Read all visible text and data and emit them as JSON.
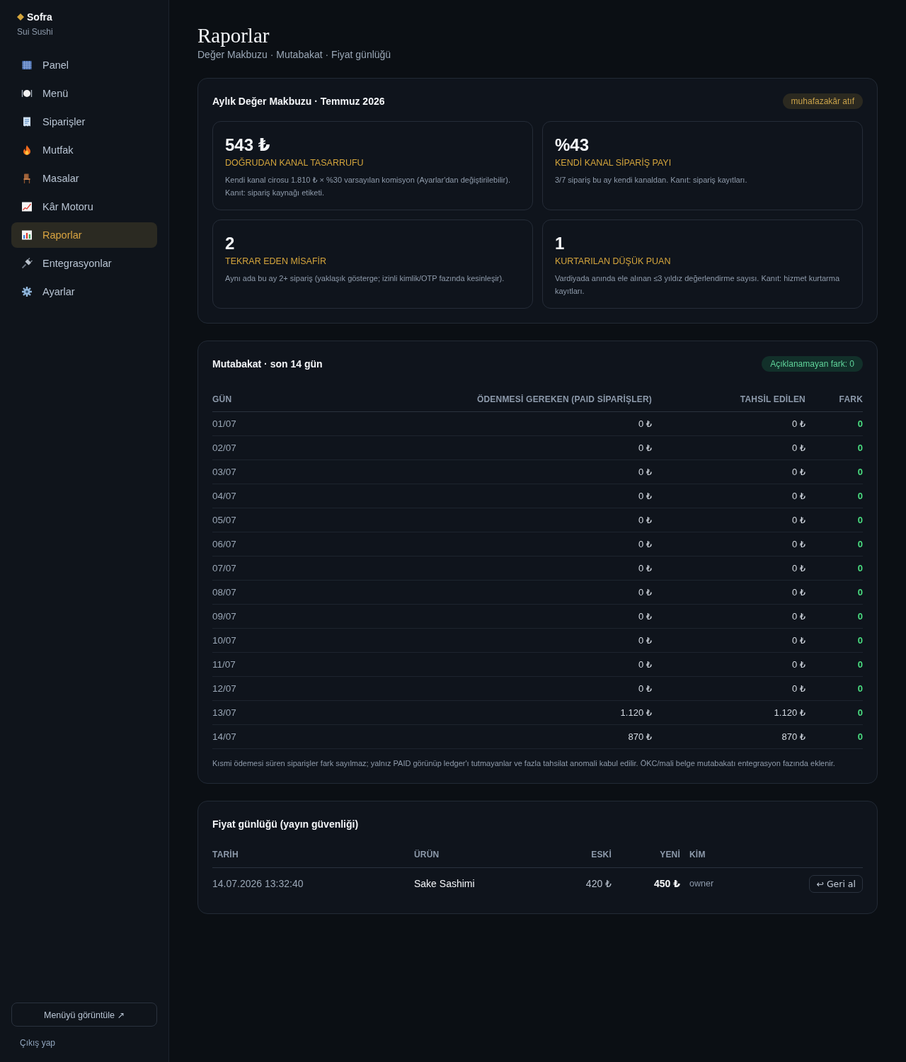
{
  "sidebar": {
    "brand": "Sofra",
    "restaurant": "Sui Sushi",
    "items": [
      {
        "label": "Panel",
        "selected": false
      },
      {
        "label": "Menü",
        "selected": false
      },
      {
        "label": "Siparişler",
        "selected": false
      },
      {
        "label": "Mutfak",
        "selected": false
      },
      {
        "label": "Masalar",
        "selected": false
      },
      {
        "label": "Kâr Motoru",
        "selected": false
      },
      {
        "label": "Raporlar",
        "selected": true
      },
      {
        "label": "Entegrasyonlar",
        "selected": false
      },
      {
        "label": "Ayarlar",
        "selected": false
      }
    ],
    "view_menu_button": "Menüyü görüntüle ↗",
    "logout_link": "Çıkış yap"
  },
  "header": {
    "title": "Raporlar",
    "subtitle": "Değer Makbuzu · Mutabakat · Fiyat günlüğü"
  },
  "value_receipt": {
    "title": "Aylık Değer Makbuzu · Temmuz 2026",
    "badge": "muhafazakâr atıf",
    "metrics": [
      {
        "value": "543 ₺",
        "label": "DOĞRUDAN KANAL TASARRUFU",
        "description": "Kendi kanal cirosu 1.810 ₺ × %30 varsayılan komisyon (Ayarlar'dan değiştirilebilir). Kanıt: sipariş kaynağı etiketi."
      },
      {
        "value": "%43",
        "label": "KENDİ KANAL SİPARİŞ PAYI",
        "description": "3/7 sipariş bu ay kendi kanaldan. Kanıt: sipariş kayıtları."
      },
      {
        "value": "2",
        "label": "TEKRAR EDEN MİSAFİR",
        "description": "Aynı ada bu ay 2+ sipariş (yaklaşık gösterge; izinli kimlik/OTP fazında kesinleşir)."
      },
      {
        "value": "1",
        "label": "KURTARILAN DÜŞÜK PUAN",
        "description": "Vardiyada anında ele alınan ≤3 yıldız değerlendirme sayısı. Kanıt: hizmet kurtarma kayıtları."
      }
    ]
  },
  "reconciliation": {
    "title": "Mutabakat · son 14 gün",
    "badge": "Açıklanamayan fark: 0",
    "columns": [
      "GÜN",
      "ÖDENMESİ GEREKEN (PAID SİPARİŞLER)",
      "TAHSİL EDİLEN",
      "FARK"
    ],
    "rows": [
      {
        "day": "01/07",
        "due": "0 ₺",
        "collected": "0 ₺",
        "difference": "0"
      },
      {
        "day": "02/07",
        "due": "0 ₺",
        "collected": "0 ₺",
        "difference": "0"
      },
      {
        "day": "03/07",
        "due": "0 ₺",
        "collected": "0 ₺",
        "difference": "0"
      },
      {
        "day": "04/07",
        "due": "0 ₺",
        "collected": "0 ₺",
        "difference": "0"
      },
      {
        "day": "05/07",
        "due": "0 ₺",
        "collected": "0 ₺",
        "difference": "0"
      },
      {
        "day": "06/07",
        "due": "0 ₺",
        "collected": "0 ₺",
        "difference": "0"
      },
      {
        "day": "07/07",
        "due": "0 ₺",
        "collected": "0 ₺",
        "difference": "0"
      },
      {
        "day": "08/07",
        "due": "0 ₺",
        "collected": "0 ₺",
        "difference": "0"
      },
      {
        "day": "09/07",
        "due": "0 ₺",
        "collected": "0 ₺",
        "difference": "0"
      },
      {
        "day": "10/07",
        "due": "0 ₺",
        "collected": "0 ₺",
        "difference": "0"
      },
      {
        "day": "11/07",
        "due": "0 ₺",
        "collected": "0 ₺",
        "difference": "0"
      },
      {
        "day": "12/07",
        "due": "0 ₺",
        "collected": "0 ₺",
        "difference": "0"
      },
      {
        "day": "13/07",
        "due": "1.120 ₺",
        "collected": "1.120 ₺",
        "difference": "0"
      },
      {
        "day": "14/07",
        "due": "870 ₺",
        "collected": "870 ₺",
        "difference": "0"
      }
    ],
    "note": "Kısmi ödemesi süren siparişler fark sayılmaz; yalnız PAID görünüp ledger'ı tutmayanlar ve fazla tahsilat anomali kabul edilir. ÖKC/mali belge mutabakatı entegrasyon fazında eklenir."
  },
  "price_log": {
    "title": "Fiyat günlüğü (yayın güvenliği)",
    "columns": [
      "TARİH",
      "ÜRÜN",
      "ESKİ",
      "YENİ",
      "KİM"
    ],
    "rows": [
      {
        "date": "14.07.2026 13:32:40",
        "product": "Sake Sashimi",
        "old_price": "420 ₺",
        "new_price": "450 ₺",
        "by": "owner",
        "action": "↩ Geri al"
      }
    ]
  }
}
